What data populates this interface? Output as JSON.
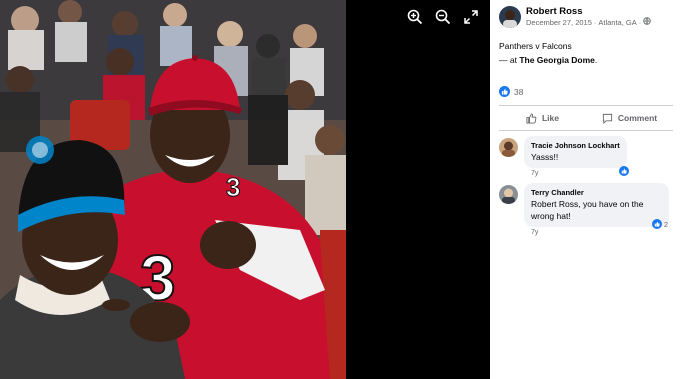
{
  "post": {
    "author": "Robert Ross",
    "date": "December 27, 2015",
    "location": "Atlanta, GA",
    "caption_line1": "Panthers v Falcons",
    "caption_prefix": "— at",
    "place": "The Georgia Dome",
    "caption_suffix": ".",
    "reaction_count": "38"
  },
  "actions": {
    "like": "Like",
    "comment": "Comment"
  },
  "comments": [
    {
      "name": "Tracie Johnson Lockhart",
      "text": "Yasss!!",
      "age": "7y",
      "reactions": ""
    },
    {
      "name": "Terry Chandler",
      "text": "Robert Ross, you have on the wrong hat!",
      "age": "7y",
      "reactions": "2"
    }
  ],
  "viewer_tools": [
    "zoom-in-icon",
    "zoom-out-icon",
    "fullscreen-icon"
  ],
  "colors": {
    "accent": "#1877f2",
    "falcons_red": "#c8102e",
    "text_secondary": "#65676b"
  }
}
